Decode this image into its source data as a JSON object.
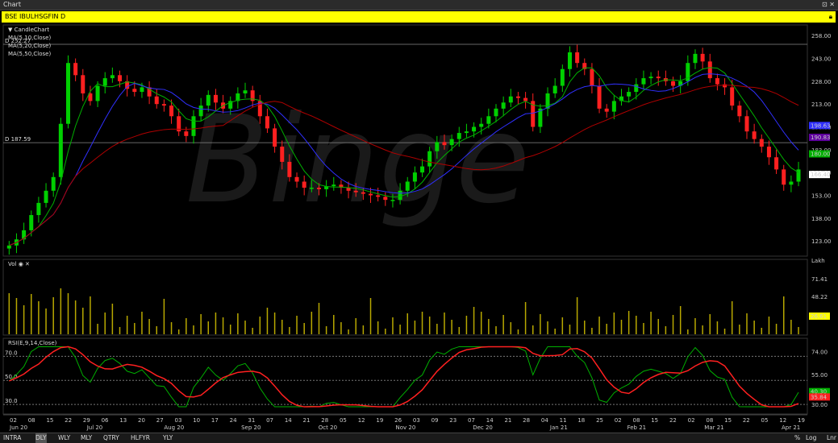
{
  "window": {
    "title": "Chart"
  },
  "symbol": {
    "label": "BSE IBULHSGFIN D"
  },
  "price_panel": {
    "legend": [
      "CandleChart",
      "MA(5,10,Close)",
      "MA(5,20,Close)",
      "MA(5,50,Close)"
    ],
    "yticks": [
      258.0,
      243.0,
      228.0,
      213.0,
      198.0,
      183.0,
      168.0,
      153.0,
      138.0,
      123.0
    ],
    "hline_labels": [
      "D 252.27",
      "D 187.59"
    ],
    "tags": [
      "198.63",
      "190.83",
      "180.00",
      "166.40"
    ]
  },
  "vol_panel": {
    "legend": "Vol",
    "unit": "Lakh",
    "yticks": [
      "71.41",
      "48.22"
    ],
    "last": "26.61"
  },
  "rsi_panel": {
    "legend": "RSI(E,9,14,Close)",
    "yticks": [
      "74.00",
      "55.00",
      "40.00",
      "30.00"
    ],
    "left_labels": [
      "70.0",
      "50.0",
      "30.0"
    ],
    "tags": [
      "40.30",
      "35.84"
    ]
  },
  "xaxis": {
    "days": [
      "02",
      "08",
      "15",
      "22",
      "29",
      "06",
      "13",
      "20",
      "27",
      "03",
      "10",
      "17",
      "24",
      "31",
      "07",
      "14",
      "21",
      "28",
      "05",
      "12",
      "19",
      "26",
      "03",
      "09",
      "23",
      "07",
      "14",
      "21",
      "28",
      "04",
      "11",
      "18",
      "25",
      "02",
      "08",
      "15",
      "22",
      "02",
      "08",
      "15",
      "22",
      "05",
      "12",
      "19"
    ],
    "months": [
      "Jun 20",
      "Jul 20",
      "Aug 20",
      "Sep 20",
      "Oct 20",
      "Nov 20",
      "Dec 20",
      "Jan 21",
      "Feb 21",
      "Mar 21",
      "Apr 21"
    ]
  },
  "bottombar": {
    "timeframes": [
      "INTRA",
      "DLY",
      "WLY",
      "MLY",
      "QTRY",
      "HLFYR",
      "YLY"
    ],
    "active": "DLY",
    "right": [
      "%",
      "Log",
      "Lnr"
    ]
  },
  "colors": {
    "up": "#00d000",
    "down": "#ff2020",
    "ma1": "#00b000",
    "ma2": "#3030ff",
    "ma3": "#b00000",
    "vol": "#b8a800",
    "rsi1": "#00b000",
    "rsi2": "#ff2020"
  },
  "chart_data": {
    "type": "candlestick",
    "title": "BSE IBULHSGFIN D",
    "y_range": [
      113,
      265
    ],
    "closes_approx": [
      120,
      124,
      130,
      140,
      148,
      156,
      165,
      200,
      240,
      232,
      220,
      215,
      225,
      230,
      232,
      228,
      223,
      221,
      224,
      218,
      213,
      212,
      205,
      195,
      192,
      205,
      212,
      219,
      214,
      210,
      215,
      220,
      222,
      215,
      205,
      197,
      185,
      175,
      165,
      162,
      158,
      158,
      157,
      159,
      160,
      158,
      156,
      155,
      154,
      153,
      152,
      150,
      150,
      156,
      162,
      168,
      172,
      182,
      188,
      186,
      190,
      194,
      195,
      198,
      200,
      205,
      210,
      214,
      218,
      217,
      215,
      198,
      210,
      220,
      225,
      236,
      247,
      240,
      236,
      225,
      210,
      208,
      215,
      218,
      221,
      226,
      230,
      231,
      230,
      228,
      225,
      228,
      240,
      246,
      241,
      230,
      226,
      224,
      212,
      205,
      195,
      190,
      185,
      178,
      170,
      160,
      162,
      170
    ]
  }
}
